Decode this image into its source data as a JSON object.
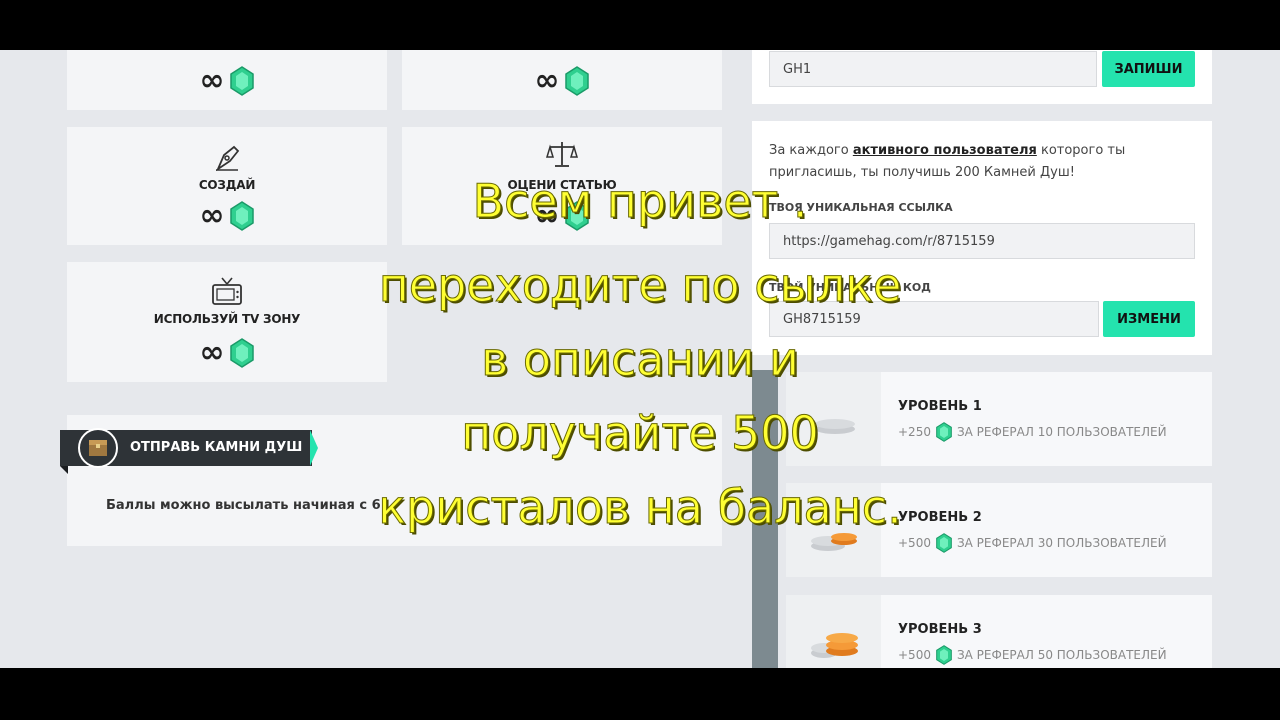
{
  "tasks": [
    {
      "title": "",
      "reward": "∞",
      "icon": "hidden-icon"
    },
    {
      "title": "",
      "reward": "∞",
      "icon": "hidden-icon"
    },
    {
      "title": "СОЗДАЙ",
      "reward": "∞",
      "icon": "pen-nib-icon"
    },
    {
      "title": "ОЦЕНИ СТАТЬЮ",
      "reward": "∞",
      "icon": "scales-icon"
    },
    {
      "title": "ИСПОЛЬЗУЙ TV ЗОНУ",
      "reward": "∞",
      "icon": "tv-icon"
    }
  ],
  "send": {
    "title": "ОТПРАВЬ КАМНИ ДУШ",
    "text": "Баллы можно высылать начиная с 6"
  },
  "code_top": {
    "value": "GH1",
    "button": "ЗАПИШИ"
  },
  "referral": {
    "text_before": "За каждого ",
    "text_link": "активного пользователя",
    "text_after": " которого ты пригласишь, ты получишь 200 Камней Душ!",
    "link_label": "ТВОЯ УНИКАЛЬНАЯ ССЫЛКА",
    "link_value": "https://gamehag.com/r/8715159",
    "code_label": "ТВОЙ УНИКАЛЬНЫЙ КОД",
    "code_value": "GH8715159",
    "code_button": "ИЗМЕНИ"
  },
  "levels": [
    {
      "title": "УРОВЕНЬ 1",
      "bonus": "+250",
      "desc": "ЗА РЕФЕРАЛ 10 ПОЛЬЗОВАТЕЛЕЙ"
    },
    {
      "title": "УРОВЕНЬ 2",
      "bonus": "+500",
      "desc": "ЗА РЕФЕРАЛ 30 ПОЛЬЗОВАТЕЛЕЙ"
    },
    {
      "title": "УРОВЕНЬ 3",
      "bonus": "+500",
      "desc": "ЗА РЕФЕРАЛ 50 ПОЛЬЗОВАТЕЛЕЙ"
    }
  ],
  "overlay_lines": [
    "Всем привет .",
    "переходите по   сылке",
    "в описании и",
    "получайте 500",
    "кристалов на баланс."
  ],
  "colors": {
    "accent": "#24e3ae",
    "gem": "#2fcf8f",
    "overlay": "#ffff33"
  }
}
